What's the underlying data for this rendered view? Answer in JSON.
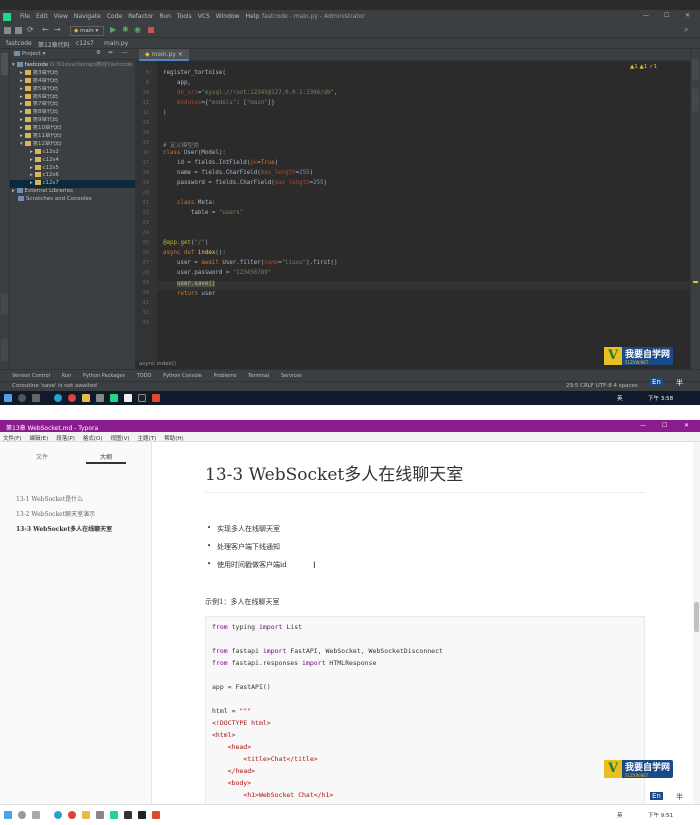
{
  "pycharm": {
    "title": "fastcode - main.py - Administrator",
    "menu": [
      "File",
      "Edit",
      "View",
      "Navigate",
      "Code",
      "Refactor",
      "Run",
      "Tools",
      "VCS",
      "Window",
      "Help"
    ],
    "run_config": "main",
    "breadcrumb": [
      "fastcode",
      "第12章代码",
      "c12s7",
      "main.py"
    ],
    "project_label": "Project",
    "project_root": "fastcode",
    "project_root_path": "D:\\51zxw\\fastapi教程\\fastcode",
    "tree": [
      "第3章代码",
      "第4章代码",
      "第5章代码",
      "第6章代码",
      "第7章代码",
      "第8章代码",
      "第9章代码",
      "第10章代码",
      "第11章代码",
      "第12章代码",
      "c12s2",
      "c12s4",
      "c12s5",
      "c12s6",
      "c12s7",
      "External Libraries",
      "Scratches and Consoles"
    ],
    "tab": "main.py",
    "inspection": "▲1  ▲1  ✓1",
    "line_numbers": [
      "8",
      "9",
      "10",
      "11",
      "12",
      "13",
      "14",
      "15",
      "16",
      "17",
      "18",
      "19",
      "20",
      "21",
      "22",
      "23",
      "24",
      "25",
      "26",
      "27",
      "28",
      "29",
      "30",
      "31",
      "32",
      "33"
    ],
    "code_crumb": "async index()",
    "tool_windows": [
      "Version Control",
      "Run",
      "Python Packages",
      "TODO",
      "Python Console",
      "Problems",
      "Terminal",
      "Services"
    ],
    "status_msg": "Coroutine 'save' is not awaited",
    "status_right": "29:5  CRLF  UTF-8  4 spaces",
    "time": "下午 3:58",
    "ime": "英",
    "en": "En",
    "half": "半"
  },
  "typora": {
    "title": "第13章 WebSocket.md - Typora",
    "menu": [
      "文件(F)",
      "编辑(E)",
      "段落(P)",
      "格式(O)",
      "视图(V)",
      "主题(T)",
      "帮助(H)"
    ],
    "tab_files": "文件",
    "tab_outline": "大纲",
    "outline": [
      "13-1 WebSocket是什么",
      "13-2 WebSocket聊天室演示",
      "13-3 WebSocket多人在线聊天室"
    ],
    "heading": "13-3 WebSocket多人在线聊天室",
    "bullets": [
      "实现多人在线聊天室",
      "处理客户端下线通知",
      "使用时间戳做客户端id"
    ],
    "example": "示例1：多人在线聊天室",
    "time": "下午 9:51",
    "ime": "英",
    "en": "En",
    "half": "半"
  },
  "logo": {
    "letter": "V",
    "text": "我要自学网",
    "url": "51ZXW.NET"
  },
  "colors": {
    "ide_bg": "#2b2b2b",
    "ide_panel": "#3c3f41",
    "typora_title": "#8b1b8e"
  }
}
